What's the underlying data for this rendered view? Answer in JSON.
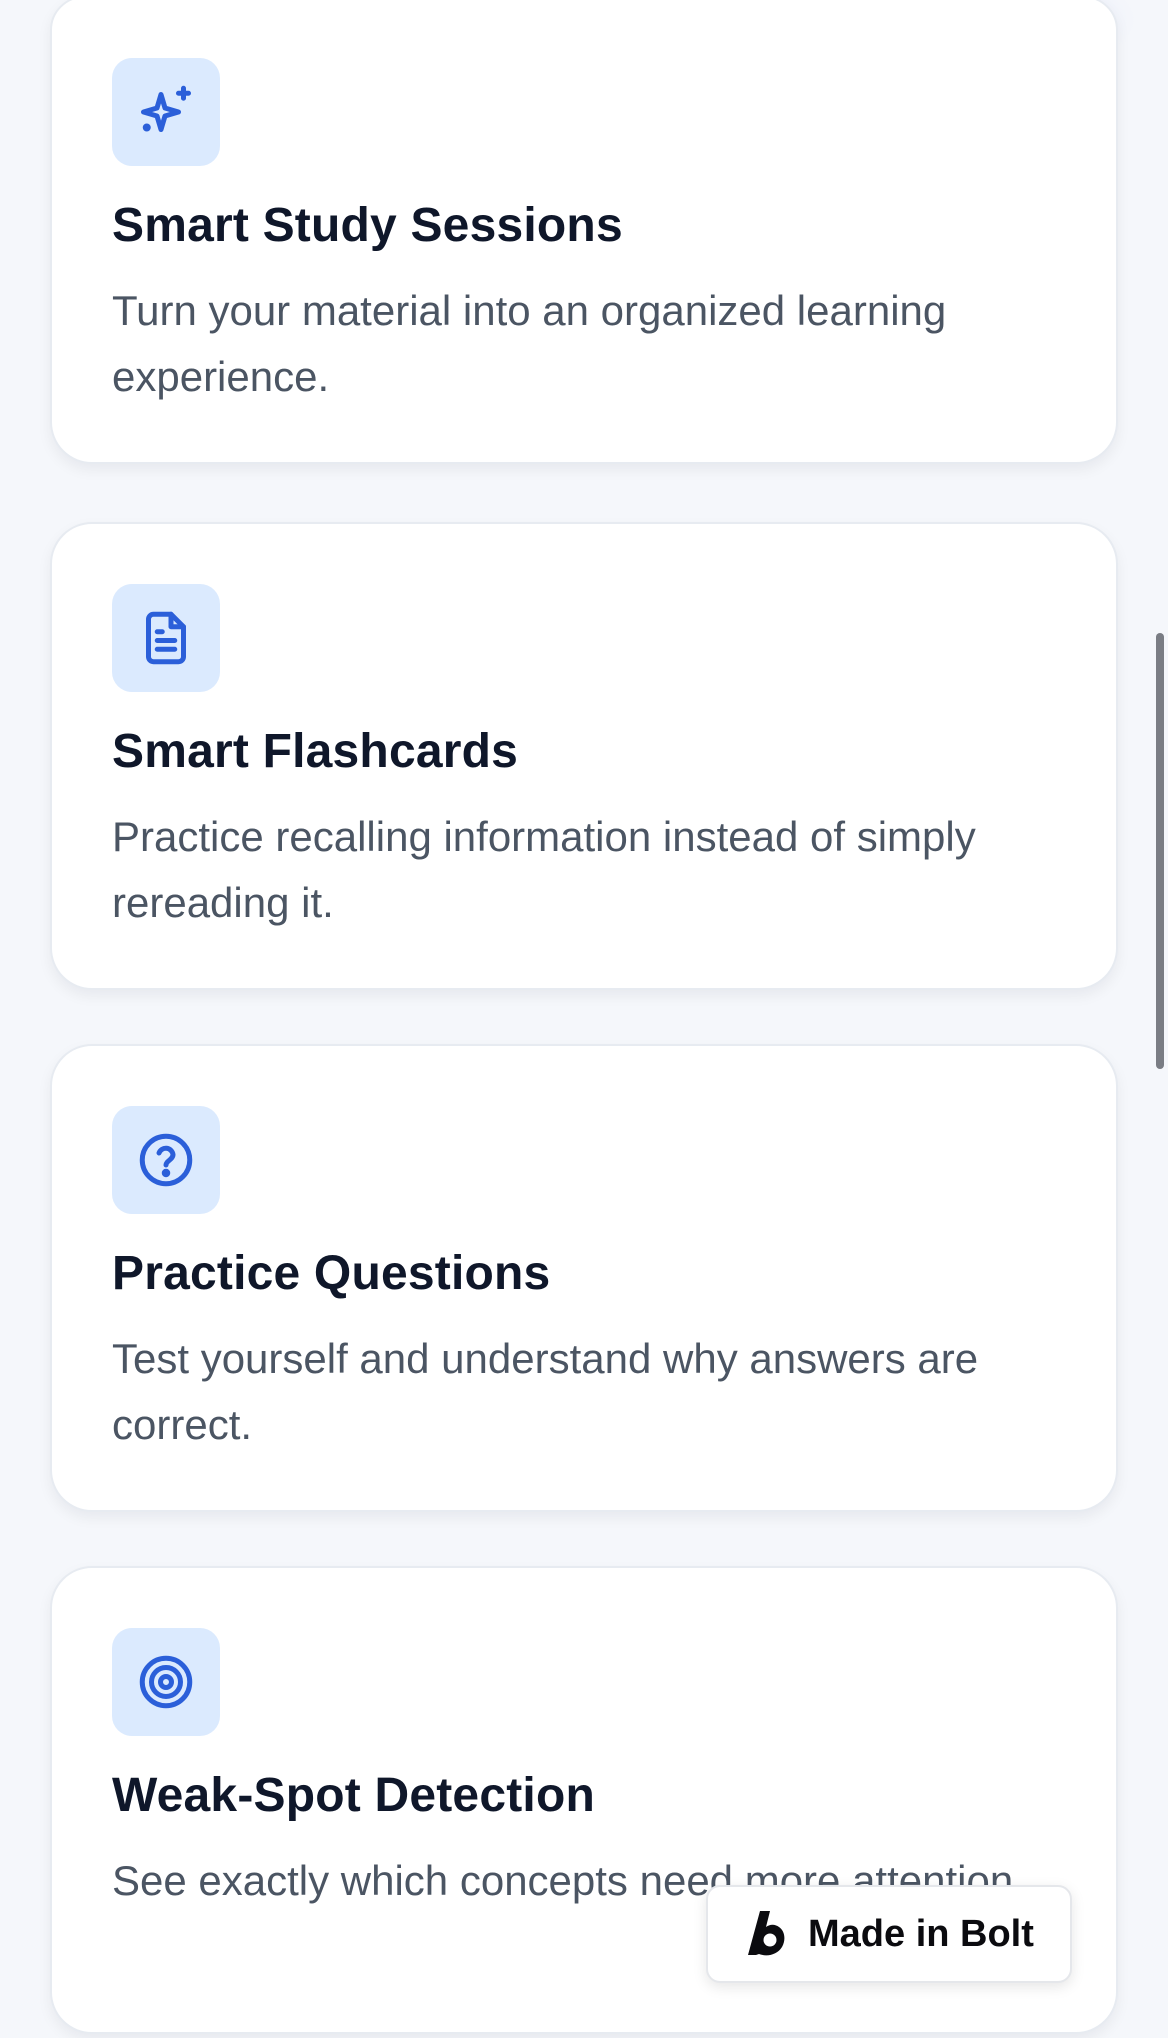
{
  "accent_color": "#2b5fd9",
  "icon_bg_color": "#dbeafe",
  "features": [
    {
      "icon": "sparkles-icon",
      "title": "Smart Study Sessions",
      "description": "Turn your material into an organized learning experience."
    },
    {
      "icon": "document-icon",
      "title": "Smart Flashcards",
      "description": "Practice recalling information instead of simply rereading it."
    },
    {
      "icon": "question-circle-icon",
      "title": "Practice Questions",
      "description": "Test yourself and understand why answers are correct."
    },
    {
      "icon": "target-icon",
      "title": "Weak-Spot Detection",
      "description": "See exactly which concepts need more attention."
    }
  ],
  "badge": {
    "label": "Made in Bolt",
    "icon": "bolt-logo-icon"
  }
}
